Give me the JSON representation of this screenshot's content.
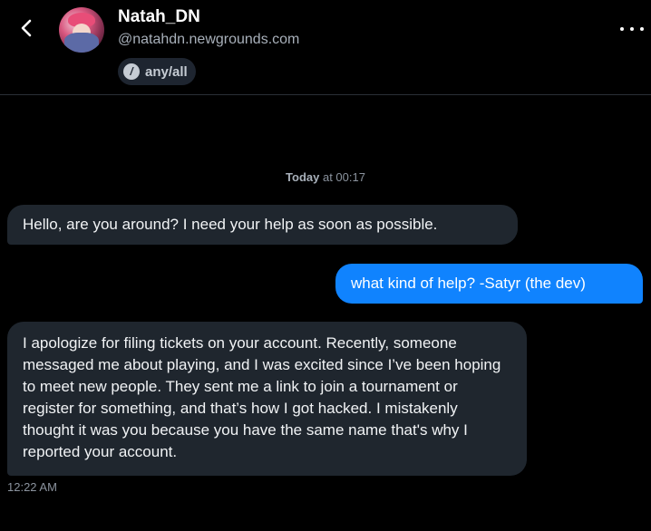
{
  "header": {
    "display_name": "Natah_DN",
    "handle": "@natahdn.newgrounds.com",
    "pronouns": "any/all",
    "pronoun_icon_glyph": "/"
  },
  "icons": {
    "back": "chevron-left-icon",
    "more": "more-horizontal-icon",
    "pronouns": "pronoun-slash-icon"
  },
  "conversation": {
    "date_separator_day": "Today",
    "date_separator_time": " at 00:17",
    "messages": [
      {
        "direction": "incoming",
        "text": "Hello, are you around? I need your help as soon as possible."
      },
      {
        "direction": "outgoing",
        "text": "what kind of help? -Satyr (the dev)"
      },
      {
        "direction": "incoming",
        "text": "I apologize for filing tickets on your account. Recently, someone messaged me about playing, and I was excited since I’ve been hoping to meet new people. They sent me a link to join a tournament or register for something, and that’s how I got hacked. I mistakenly thought it was you because you have the same name that's why I reported your account."
      }
    ],
    "last_timestamp": "12:22 AM"
  },
  "colors": {
    "background": "#000000",
    "incoming_bubble": "#1f262e",
    "outgoing_bubble": "#1083fe",
    "secondary_text": "#8b939e"
  }
}
